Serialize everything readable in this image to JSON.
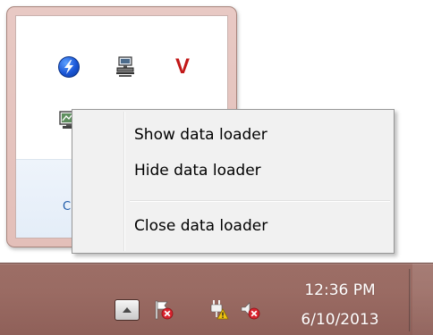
{
  "flyout": {
    "customize_link": "C"
  },
  "context_menu": {
    "items": [
      {
        "label": "Show data loader"
      },
      {
        "label": "Hide data loader"
      },
      {
        "label": "Close data loader"
      }
    ]
  },
  "tray_icons": {
    "flyout_row1": [
      "flash-icon",
      "network-manager-icon",
      "v-icon"
    ],
    "flyout_row2": [
      "data-loader-icon",
      "green-status-icon"
    ],
    "taskbar": [
      "action-center-flag-icon",
      "power-warning-icon",
      "volume-muted-icon"
    ],
    "v_glyph": "V"
  },
  "taskbar": {
    "time": "12:36 PM",
    "date": "6/10/2013"
  },
  "colors": {
    "taskbar": "#9a6b63",
    "flyout_border": "#e3bfb9",
    "menu_background": "#f1f1f1",
    "error_badge": "#d9232e",
    "warning_badge": "#f1c40f",
    "accent_blue": "#1a56d6",
    "v_red": "#c21818"
  }
}
